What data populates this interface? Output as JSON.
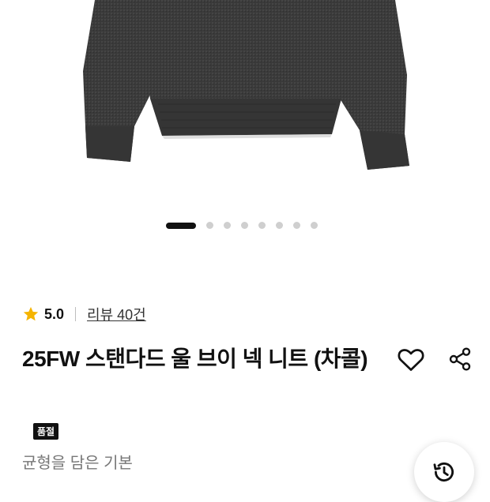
{
  "product": {
    "rating": {
      "score": "5.0",
      "reviews_label": "리뷰 40건",
      "star_icon": "star-icon"
    },
    "title": "25FW 스탠다드 울 브이 넥 니트 (차콜)",
    "badge": "품절",
    "subtitle": "균형을 담은 기본"
  },
  "carousel": {
    "total": 8,
    "active_index": 1
  },
  "colors": {
    "accent_star": "#F5B400",
    "text": "#111111",
    "muted": "#777777",
    "sweater": "#3a3a3a"
  },
  "icons": {
    "like": "heart-icon",
    "share": "share-icon",
    "history": "history-icon"
  }
}
